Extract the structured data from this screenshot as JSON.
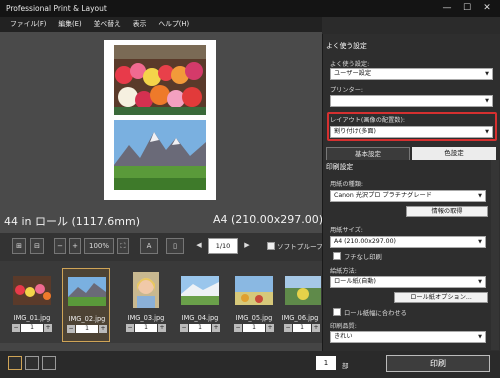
{
  "window": {
    "title": "Professional Print & Layout",
    "controls": [
      "—",
      "☐",
      "✕"
    ]
  },
  "menu": [
    "ファイル(F)",
    "編集(E)",
    "並べ替え",
    "表示",
    "ヘルプ(H)"
  ],
  "canvas": {
    "roll_label": "44 in ロール (1117.6mm)",
    "size_label": "A4 (210.00x297.00)"
  },
  "toolbar": {
    "zoom": "100%",
    "page": "1/10",
    "softproof": "ソフトプルーフ",
    "font_btn": "A"
  },
  "thumbnails": [
    {
      "name": "IMG_01.jpg",
      "qty": "1"
    },
    {
      "name": "IMG_02.jpg",
      "qty": "1"
    },
    {
      "name": "IMG_03.jpg",
      "qty": "1"
    },
    {
      "name": "IMG_04.jpg",
      "qty": "1"
    },
    {
      "name": "IMG_05.jpg",
      "qty": "1"
    },
    {
      "name": "IMG_06.jpg",
      "qty": "1"
    }
  ],
  "panel": {
    "favorites_head": "よく使う設定",
    "favorites_label": "よく使う設定:",
    "favorites_value": "ユーザー設定",
    "printer_label": "プリンター:",
    "layout_label": "レイアウト(画像の配置数):",
    "layout_value": "割り付け(多面)",
    "tab_basic": "基本設定",
    "tab_color": "色設定",
    "print_settings": "印刷設定",
    "media_label": "用紙の種類:",
    "media_value": "Canon 光沢プロ プラチナグレード",
    "info_btn": "情報の取得",
    "size_label": "用紙サイズ:",
    "size_value": "A4 (210.00x297.00)",
    "borderless": "フチなし印刷",
    "paper_source_label": "給紙方法:",
    "paper_source_value": "ロール紙(自動)",
    "roll_options_btn": "ロール紙オプション...",
    "fit_roll": "ロール紙幅に合わせる",
    "quality_label": "印刷品質:",
    "quality_value": "きれい"
  },
  "bottom": {
    "copies": "1",
    "copies_unit": "部",
    "print_btn": "印刷"
  }
}
